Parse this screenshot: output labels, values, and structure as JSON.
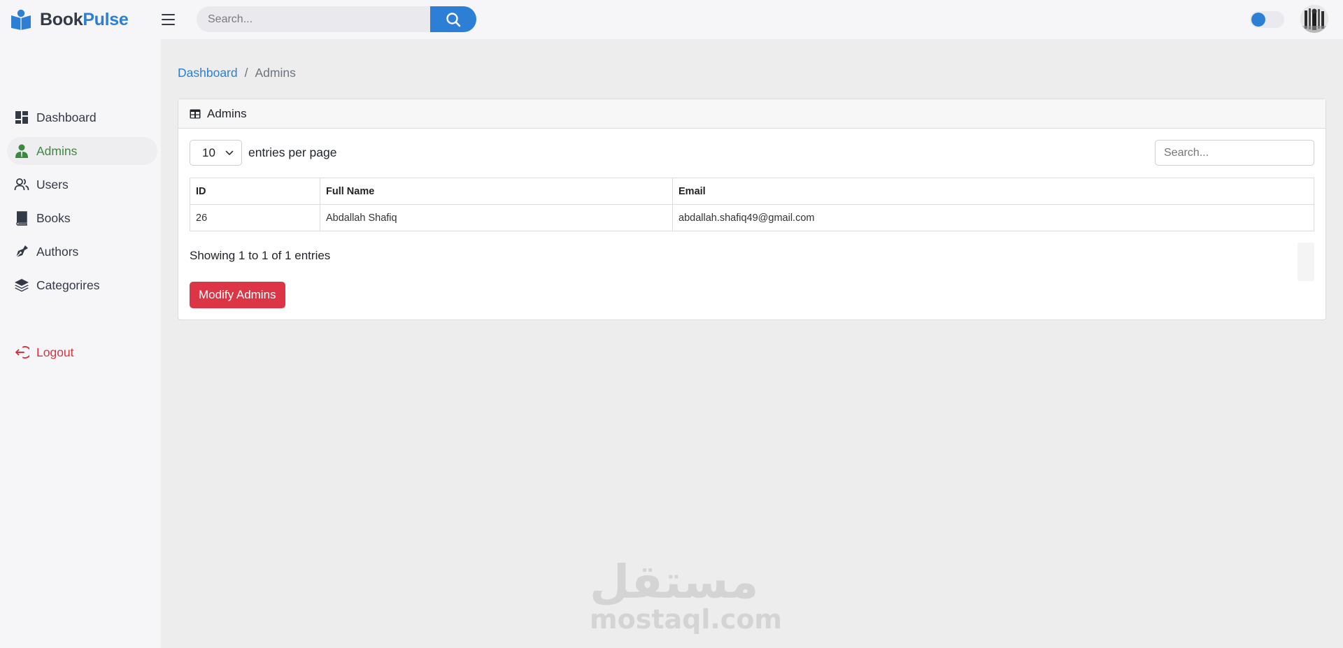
{
  "brand": {
    "part1": "Book",
    "part2": "Pulse",
    "primary_color": "#2d7fd6"
  },
  "topbar": {
    "search_placeholder": "Search...",
    "search_icon": "search-icon",
    "menu_icon": "hamburger-icon",
    "theme_toggle_on": true
  },
  "sidebar": {
    "items": [
      {
        "label": "Dashboard",
        "icon": "dashboard-icon"
      },
      {
        "label": "Admins",
        "icon": "admin-icon",
        "active": true
      },
      {
        "label": "Users",
        "icon": "users-icon"
      },
      {
        "label": "Books",
        "icon": "book-icon"
      },
      {
        "label": "Authors",
        "icon": "pen-icon"
      },
      {
        "label": "Categorires",
        "icon": "layers-icon"
      }
    ],
    "logout": {
      "label": "Logout",
      "icon": "logout-icon"
    }
  },
  "breadcrumb": {
    "root": "Dashboard",
    "separator": "/",
    "current": "Admins"
  },
  "card": {
    "title": "Admins",
    "title_icon": "table-icon",
    "entries_value": "10",
    "entries_label": "entries per page",
    "search_placeholder": "Search...",
    "columns": [
      "ID",
      "Full Name",
      "Email"
    ],
    "rows": [
      {
        "id": "26",
        "name": "Abdallah Shafiq",
        "email": "abdallah.shafiq49@gmail.com"
      }
    ],
    "showing": "Showing 1 to 1 of 1 entries",
    "modify_button": "Modify Admins",
    "danger_color": "#dc3545"
  },
  "watermark": {
    "arabic": "مستقل",
    "latin": "mostaql.com"
  }
}
